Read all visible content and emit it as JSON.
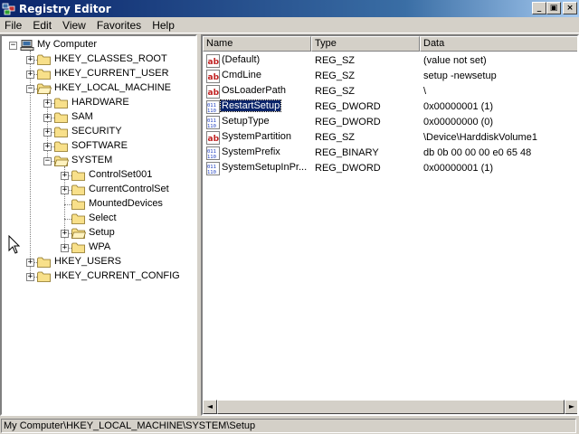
{
  "window": {
    "title": "Registry Editor",
    "buttons": {
      "minimize": "_",
      "maximize": "▣",
      "close": "×"
    }
  },
  "menu": [
    "File",
    "Edit",
    "View",
    "Favorites",
    "Help"
  ],
  "tree": {
    "items": [
      {
        "label": "My Computer",
        "expander": "−"
      },
      {
        "label": "HKEY_CLASSES_ROOT",
        "expander": "+"
      },
      {
        "label": "HKEY_CURRENT_USER",
        "expander": "+"
      },
      {
        "label": "HKEY_LOCAL_MACHINE",
        "expander": "−"
      },
      {
        "label": "HARDWARE",
        "expander": "+"
      },
      {
        "label": "SAM",
        "expander": "+"
      },
      {
        "label": "SECURITY",
        "expander": "+"
      },
      {
        "label": "SOFTWARE",
        "expander": "+"
      },
      {
        "label": "SYSTEM",
        "expander": "−"
      },
      {
        "label": "ControlSet001",
        "expander": "+"
      },
      {
        "label": "CurrentControlSet",
        "expander": "+"
      },
      {
        "label": "MountedDevices",
        "expander": ""
      },
      {
        "label": "Select",
        "expander": ""
      },
      {
        "label": "Setup",
        "expander": "+"
      },
      {
        "label": "WPA",
        "expander": "+"
      },
      {
        "label": "HKEY_USERS",
        "expander": "+"
      },
      {
        "label": "HKEY_CURRENT_CONFIG",
        "expander": "+"
      }
    ]
  },
  "list": {
    "columns": [
      "Name",
      "Type",
      "Data"
    ],
    "rows": [
      {
        "icon": "string-value-icon",
        "name": "(Default)",
        "type": "REG_SZ",
        "data": "(value not set)"
      },
      {
        "icon": "string-value-icon",
        "name": "CmdLine",
        "type": "REG_SZ",
        "data": "setup -newsetup"
      },
      {
        "icon": "string-value-icon",
        "name": "OsLoaderPath",
        "type": "REG_SZ",
        "data": "\\"
      },
      {
        "icon": "binary-value-icon",
        "name": "RestartSetup",
        "type": "REG_DWORD",
        "data": "0x00000001 (1)",
        "selected": true
      },
      {
        "icon": "binary-value-icon",
        "name": "SetupType",
        "type": "REG_DWORD",
        "data": "0x00000000 (0)"
      },
      {
        "icon": "string-value-icon",
        "name": "SystemPartition",
        "type": "REG_SZ",
        "data": "\\Device\\HarddiskVolume1"
      },
      {
        "icon": "binary-value-icon",
        "name": "SystemPrefix",
        "type": "REG_BINARY",
        "data": "db 0b 00 00 00 e0 65 48"
      },
      {
        "icon": "binary-value-icon",
        "name": "SystemSetupInPr...",
        "type": "REG_DWORD",
        "data": "0x00000001 (1)"
      }
    ]
  },
  "scrollbar": {
    "left_arrow": "◄",
    "right_arrow": "►"
  },
  "status": "My Computer\\HKEY_LOCAL_MACHINE\\SYSTEM\\Setup",
  "colors": {
    "titlebar": "#0a246a",
    "selection": "#0a246a",
    "folder": "#f8e08a"
  }
}
